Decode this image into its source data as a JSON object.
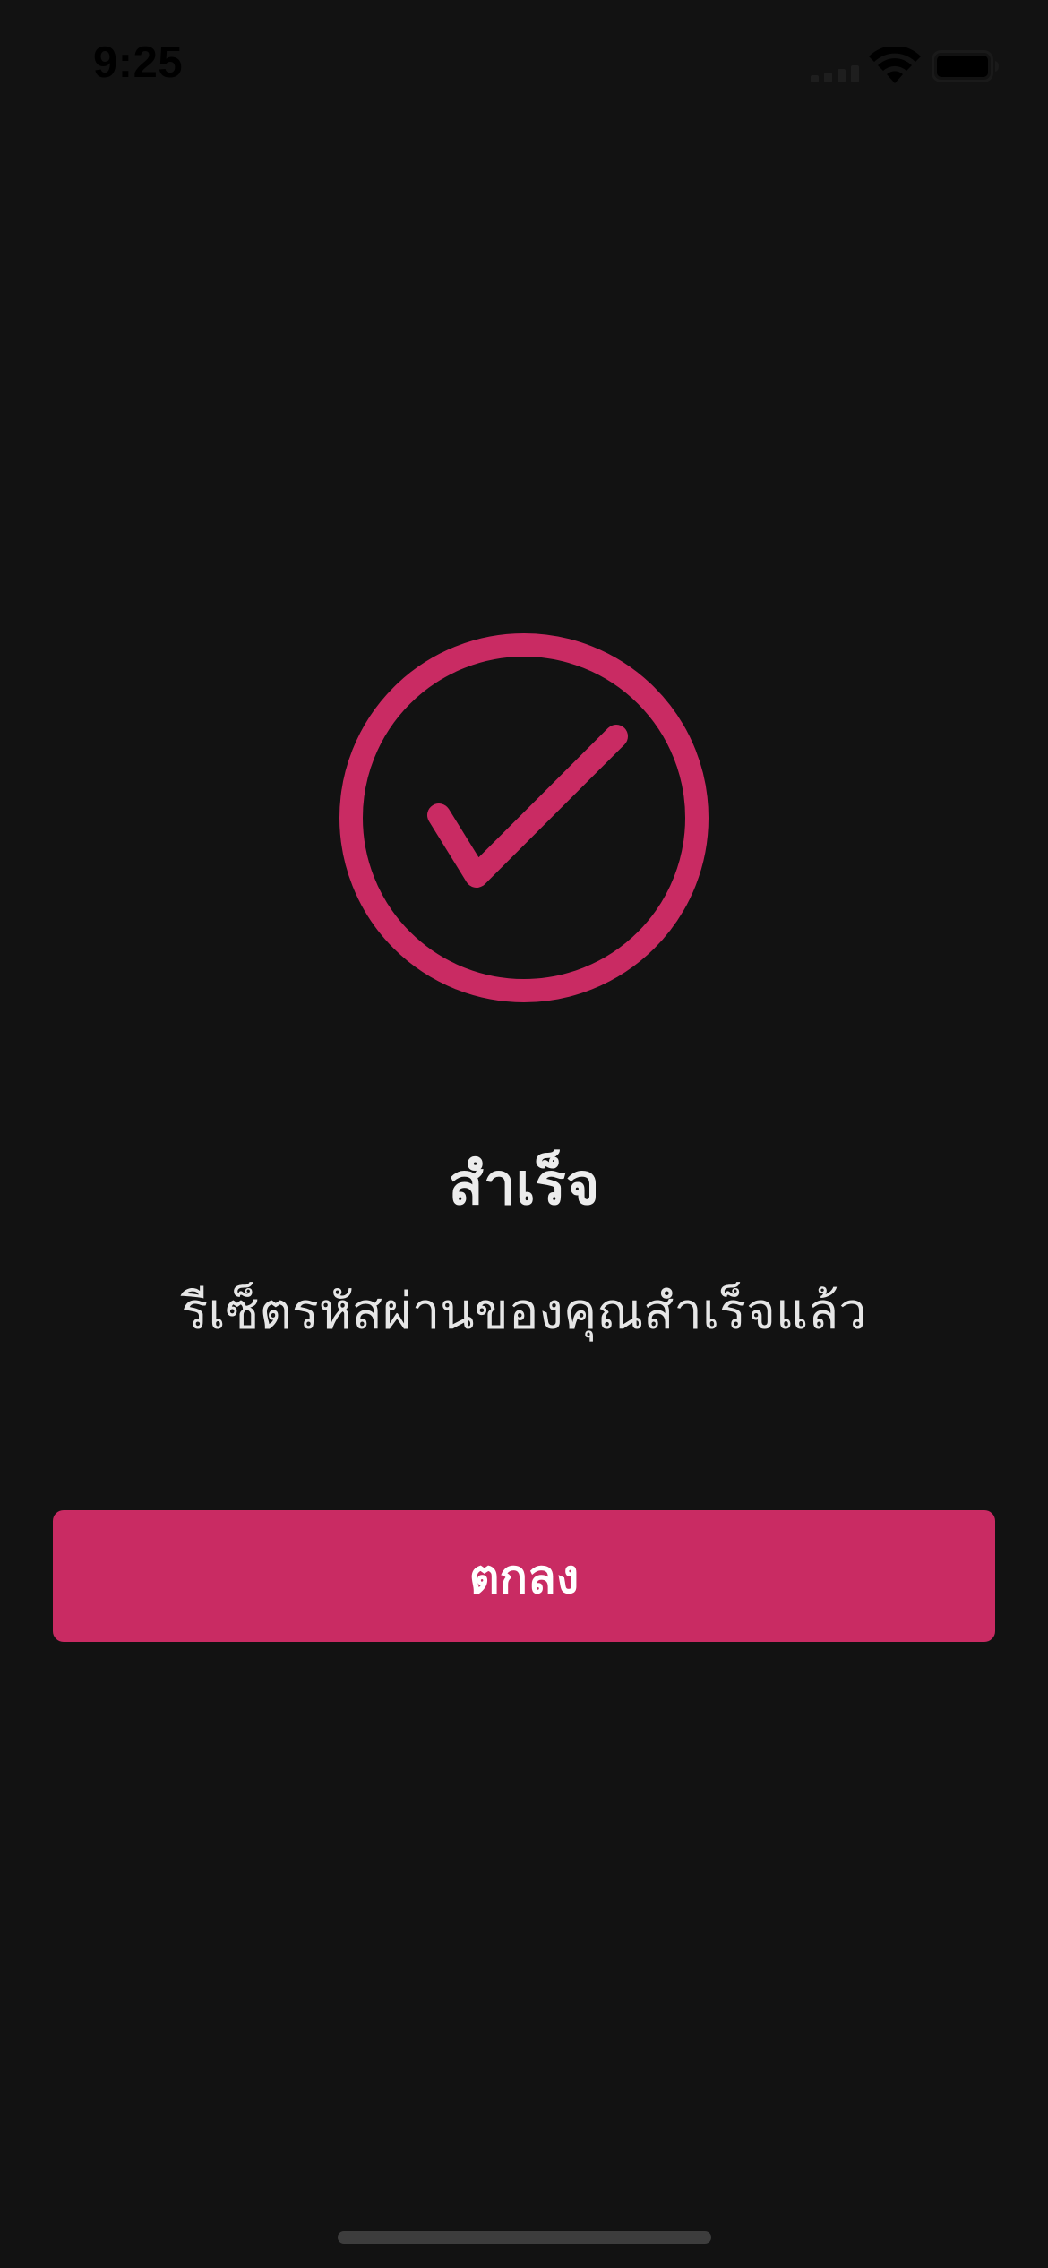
{
  "status_bar": {
    "time": "9:25"
  },
  "icons": {
    "success": "checkmark-circle-icon",
    "signal": "cellular-signal-icon",
    "wifi": "wifi-icon",
    "battery": "battery-icon"
  },
  "colors": {
    "background": "#121212",
    "accent": "#c92b63",
    "text": "#e9e9e9"
  },
  "dialog": {
    "title": "สำเร็จ",
    "message": "รีเซ็ตรหัสผ่านของคุณสำเร็จแล้ว",
    "ok_label": "ตกลง"
  }
}
